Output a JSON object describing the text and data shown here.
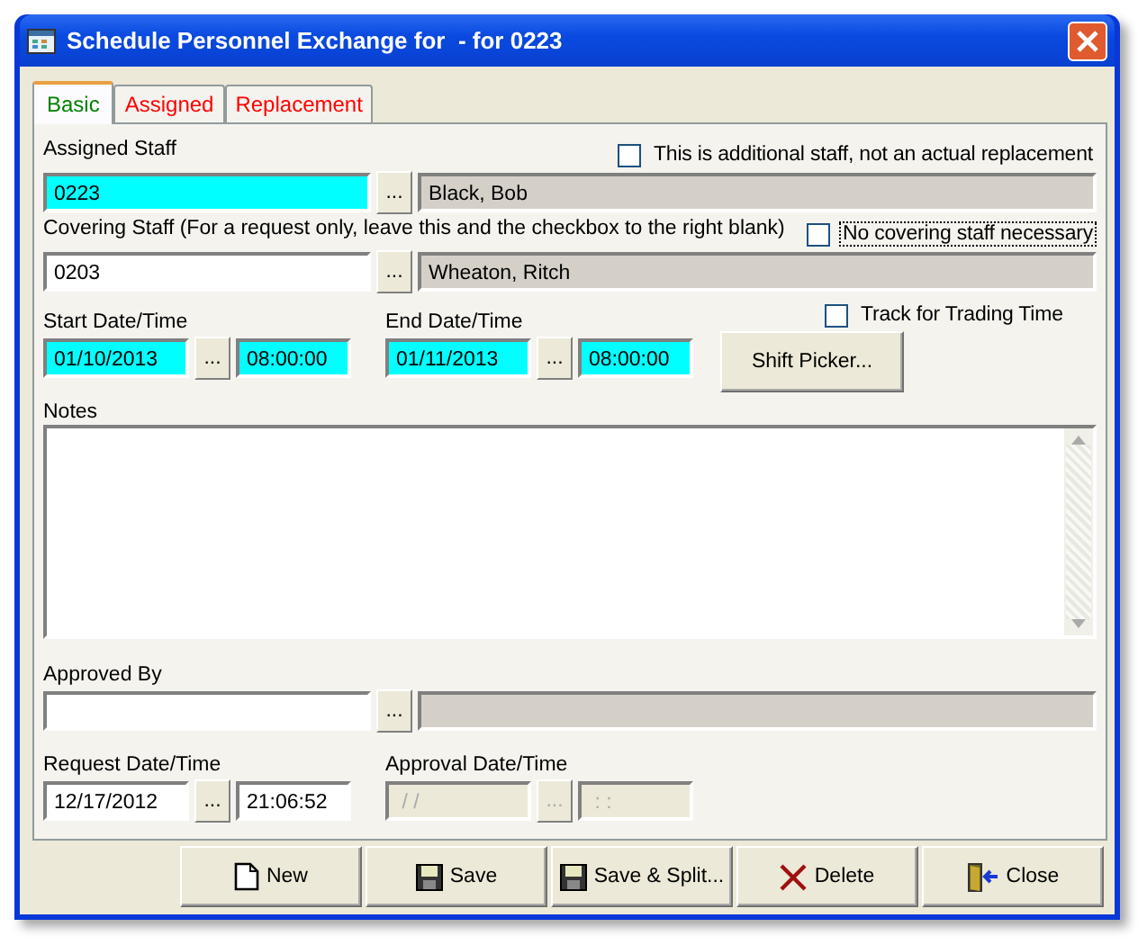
{
  "window": {
    "title": "Schedule Personnel Exchange for  - for 0223"
  },
  "tabs": [
    {
      "label": "Basic",
      "selected": true,
      "color": "#008000"
    },
    {
      "label": "Assigned",
      "selected": false,
      "color": "#ff0000"
    },
    {
      "label": "Replacement",
      "selected": false,
      "color": "#ff0000"
    }
  ],
  "assigned_staff": {
    "label": "Assigned Staff",
    "code": "0223",
    "name": "Black, Bob",
    "required": true,
    "lookup": "...",
    "option": {
      "label": "This is additional staff, not an actual replacement",
      "checked": false,
      "focused": false
    }
  },
  "covering_staff": {
    "label": "Covering Staff (For a request only, leave this and the checkbox to the right blank)",
    "code": "0203",
    "name": "Wheaton, Ritch",
    "required": false,
    "lookup": "...",
    "option": {
      "label": "No covering staff necessary",
      "checked": false,
      "focused": true
    }
  },
  "start": {
    "label": "Start Date/Time",
    "date": "01/10/2013",
    "time": "08:00:00",
    "required": true,
    "disabled": false,
    "lookup": "..."
  },
  "end": {
    "label": "End Date/Time",
    "date": "01/11/2013",
    "time": "08:00:00",
    "required": true,
    "disabled": false,
    "lookup": "..."
  },
  "track_trading_time": {
    "label": "Track for Trading Time",
    "checked": false
  },
  "shift_picker": {
    "label": "Shift Picker..."
  },
  "notes": {
    "label": "Notes"
  },
  "approved_by": {
    "label": "Approved By",
    "lookup": "..."
  },
  "request": {
    "label": "Request Date/Time",
    "date": "12/17/2012",
    "time": "21:06:52",
    "disabled": false,
    "lookup": "..."
  },
  "approval": {
    "label": "Approval Date/Time",
    "date": " / /",
    "time": " : :",
    "disabled": true,
    "lookup": "..."
  },
  "buttons": [
    {
      "kind": "new",
      "label": "New"
    },
    {
      "kind": "save",
      "label": "Save"
    },
    {
      "kind": "save",
      "label": "Save & Split..."
    },
    {
      "kind": "delete",
      "label": "Delete"
    },
    {
      "kind": "close",
      "label": "Close"
    }
  ]
}
